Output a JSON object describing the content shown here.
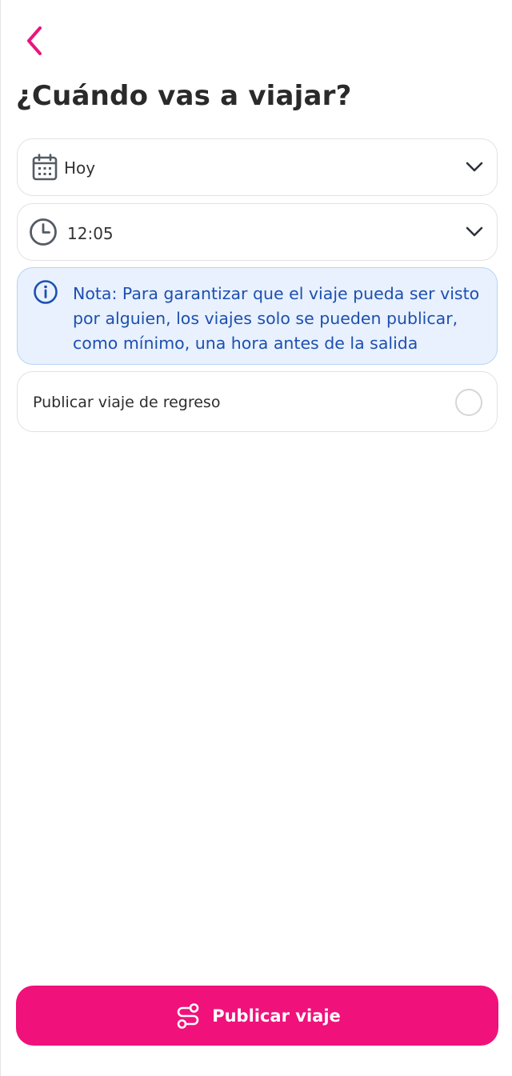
{
  "header": {
    "title": "¿Cuándo vas a viajar?"
  },
  "date_field": {
    "value": "Hoy",
    "icon": "calendar-icon"
  },
  "time_field": {
    "value": "12:05",
    "icon": "clock-icon"
  },
  "note": {
    "text": "Nota: Para garantizar que el viaje pueda ser visto por alguien, los viajes solo se pueden publicar, como mínimo, una hora antes de la salida",
    "icon": "info-icon"
  },
  "return_trip": {
    "label": "Publicar viaje de regreso",
    "selected": false
  },
  "publish_button": {
    "label": "Publicar viaje",
    "icon": "route-icon"
  },
  "colors": {
    "accent": "#f0117b",
    "note_bg": "#e8f1fd",
    "note_text": "#1e4fb0"
  }
}
